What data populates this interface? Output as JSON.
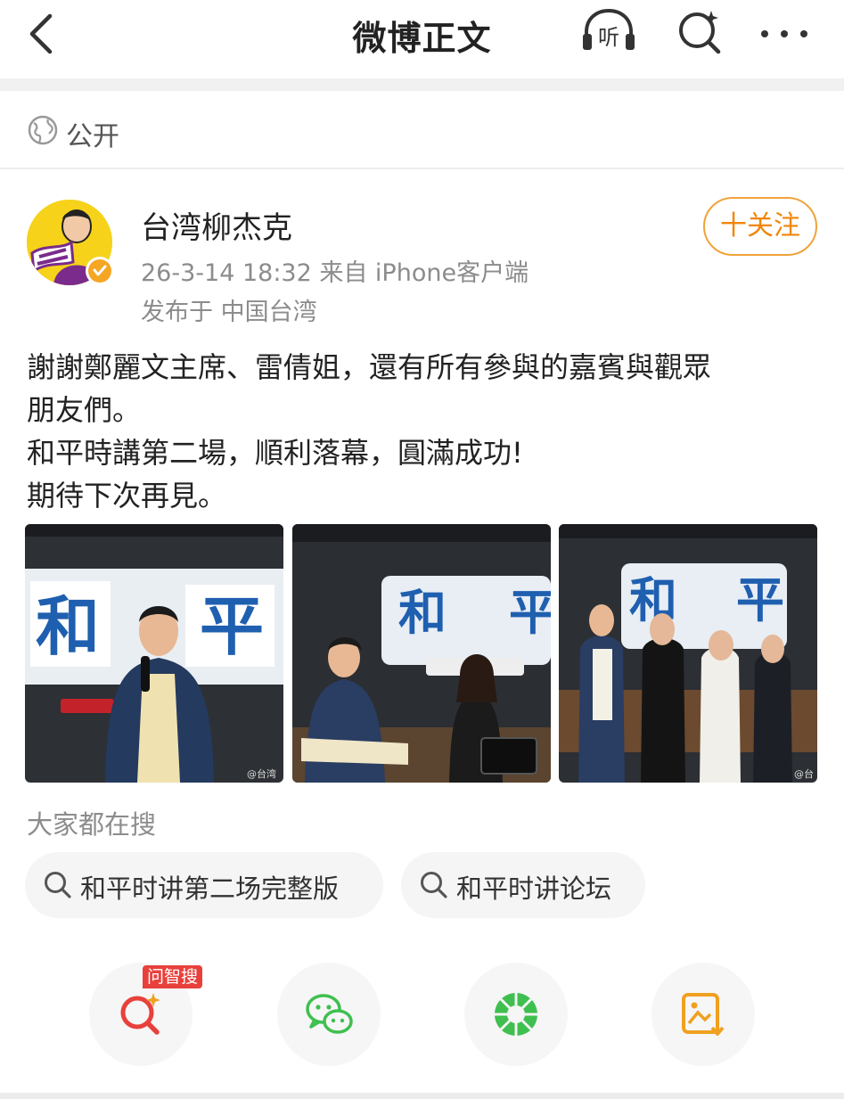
{
  "header": {
    "title": "微博正文",
    "listen_label": "听"
  },
  "visibility": {
    "label": "公开"
  },
  "author": {
    "name": "台湾柳杰克",
    "follow_label": "十关注"
  },
  "post": {
    "meta": "26-3-14 18:32  来自 iPhone客户端",
    "location": "发布于 中国台湾",
    "lines": [
      "謝謝鄭麗文主席、雷倩姐，還有所有參與的嘉賓與觀眾",
      "朋友們。",
      "和平時講第二場，順利落幕，圓滿成功!",
      "期待下次再見。"
    ],
    "photos": [
      {
        "sign_line1": "和",
        "sign_line2": "平",
        "watermark": "@台湾"
      },
      {
        "sign_line1": "和",
        "sign_line2": "平",
        "watermark": ""
      },
      {
        "sign_line1": "和",
        "sign_line2": "平",
        "watermark": "@台"
      }
    ]
  },
  "trending": {
    "heading": "大家都在搜",
    "chips": [
      "和平时讲第二场完整版",
      "和平时讲论坛"
    ]
  },
  "actions": {
    "badge": "问智搜",
    "items": [
      "ai-search-icon",
      "wechat-icon",
      "moments-icon",
      "save-image-icon"
    ]
  },
  "colors": {
    "accent": "#f0860a",
    "badge": "#e8413c",
    "wechat": "#3fbf4f",
    "ai_search": "#e8413c"
  }
}
